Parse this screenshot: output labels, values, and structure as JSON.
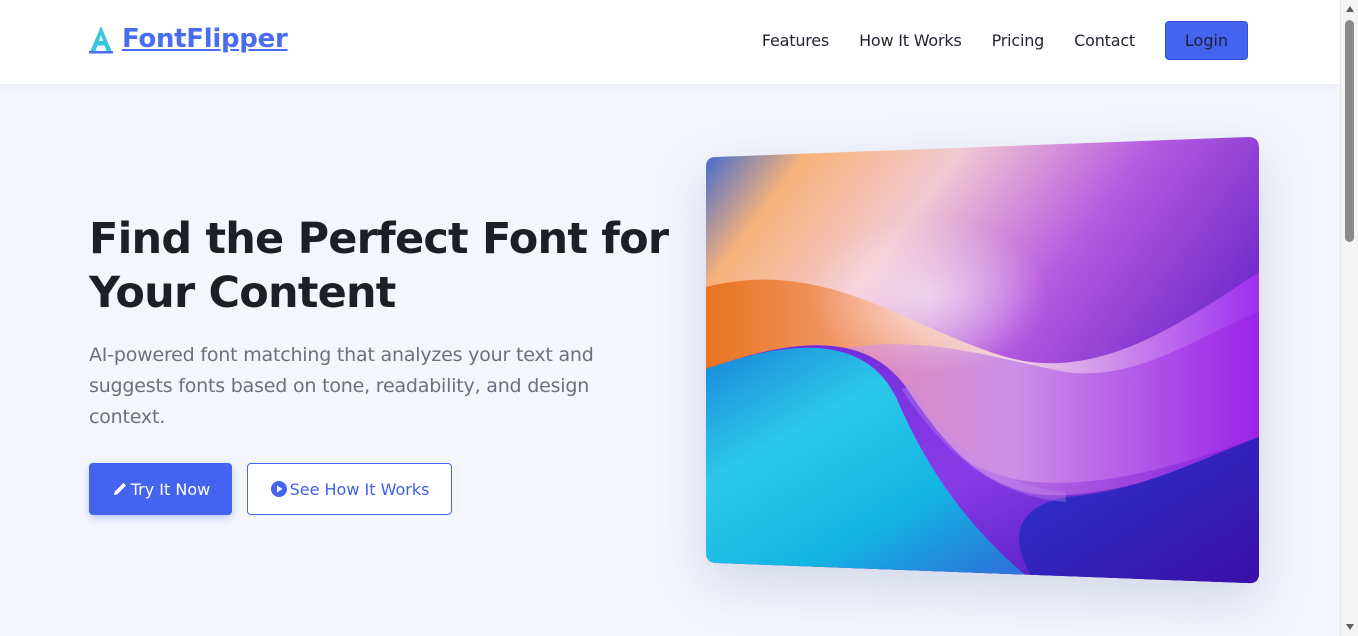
{
  "brand": {
    "logo_text": "FontFlipper",
    "logo_icon": "letter-a-icon",
    "primary_color": "#4463ef",
    "accent_color": "#38c6e0"
  },
  "nav": {
    "items": [
      "Features",
      "How It Works",
      "Pricing",
      "Contact"
    ],
    "login_label": "Login"
  },
  "hero": {
    "title": "Find the Perfect Font for Your Content",
    "subtitle": "AI-powered font matching that analyzes your text and suggests fonts based on tone, readability, and design context.",
    "primary_button": {
      "label": "Try It Now",
      "icon": "pencil-icon"
    },
    "secondary_button": {
      "label": "See How It Works",
      "icon": "play-circle-icon"
    }
  },
  "hero_image": {
    "icon": "abstract-gradient-wave-image",
    "colors": [
      "#1f5bd6",
      "#f28a3c",
      "#a64be6",
      "#22c6e8",
      "#5b1ec0"
    ]
  }
}
